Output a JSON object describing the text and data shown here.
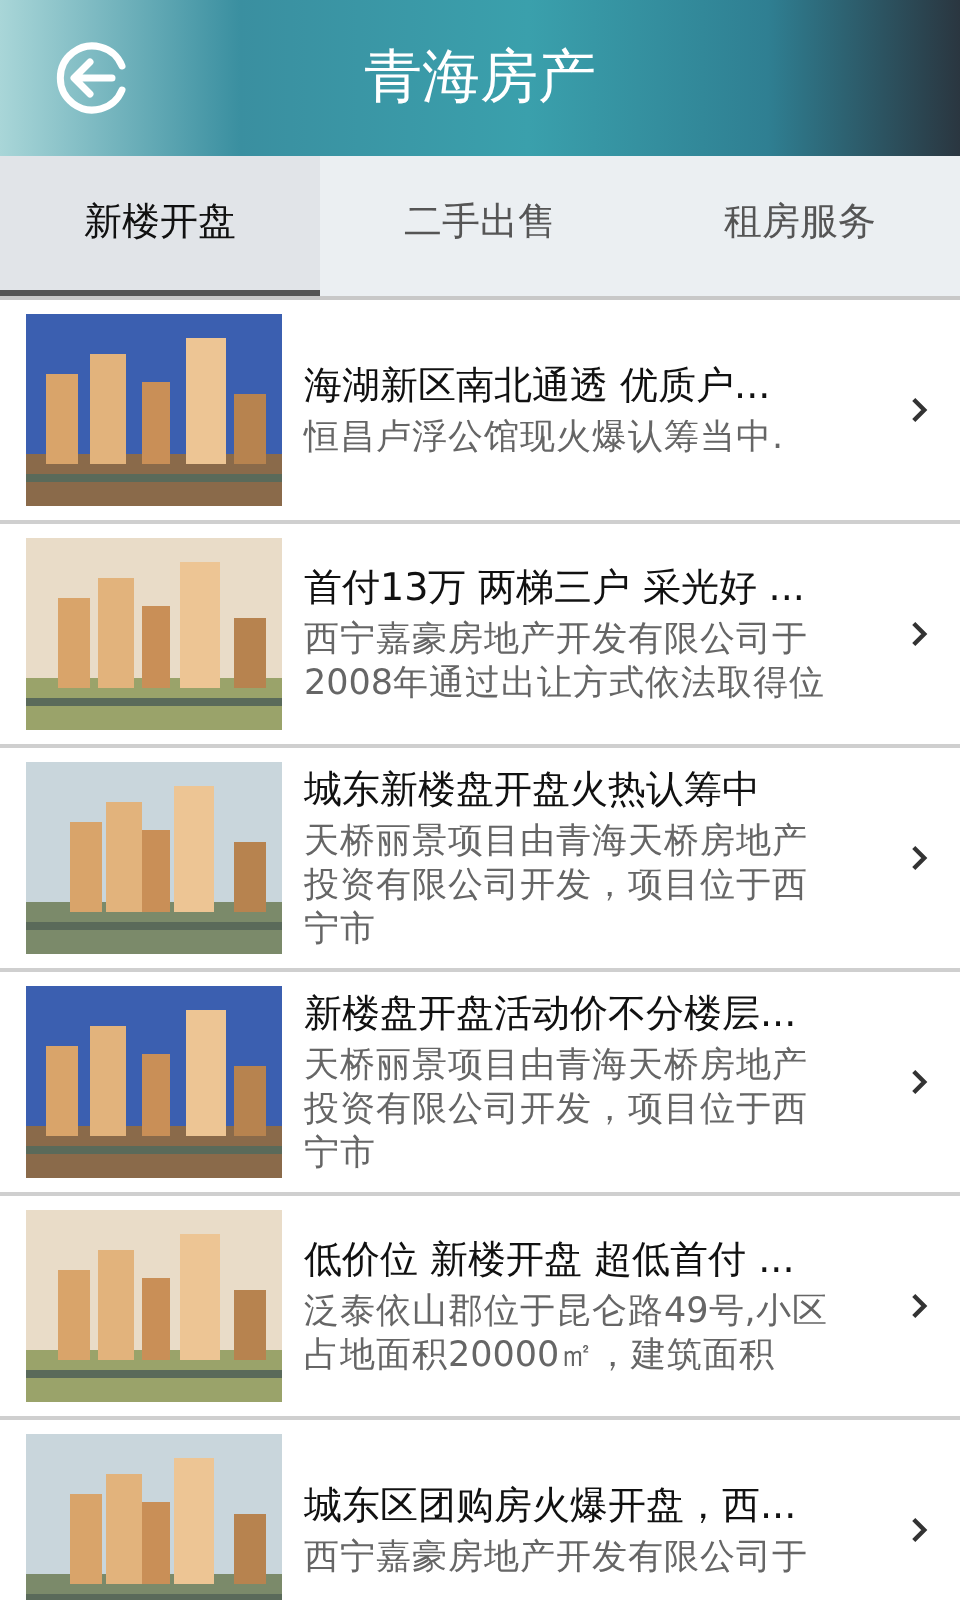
{
  "header": {
    "title": "青海房产"
  },
  "tabs": [
    {
      "label": "新楼开盘",
      "selected": true
    },
    {
      "label": "二手出售",
      "selected": false
    },
    {
      "label": "租房服务",
      "selected": false
    }
  ],
  "listings": [
    {
      "title": "海湖新区南北通透 优质户...",
      "description": "恒昌卢浮公馆现火爆认筹当中."
    },
    {
      "title": "首付13万 两梯三户 采光好 ...",
      "description": "西宁嘉豪房地产开发有限公司于2008年通过出让方式依法取得位"
    },
    {
      "title": "城东新楼盘开盘火热认筹中",
      "description": "天桥丽景项目由青海天桥房地产投资有限公司开发，项目位于西宁市"
    },
    {
      "title": "新楼盘开盘活动价不分楼层...",
      "description": "天桥丽景项目由青海天桥房地产投资有限公司开发，项目位于西宁市"
    },
    {
      "title": "低价位 新楼开盘 超低首付 ...",
      "description": "泛泰依山郡位于昆仑路49号,小区占地面积20000㎡，建筑面积"
    },
    {
      "title": "城东区团购房火爆开盘，西...",
      "description": "西宁嘉豪房地产开发有限公司于"
    }
  ]
}
